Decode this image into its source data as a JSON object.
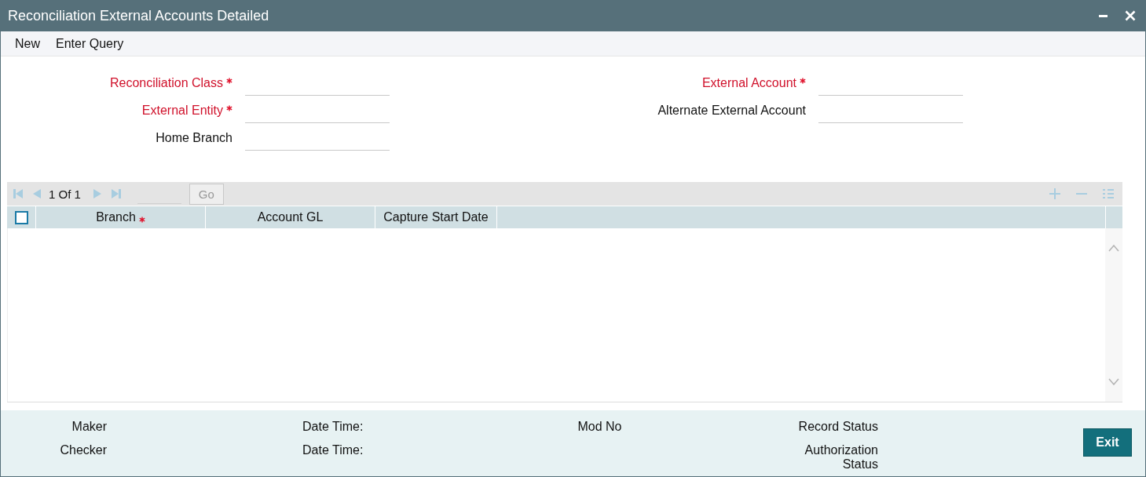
{
  "window": {
    "title": "Reconciliation External Accounts Detailed"
  },
  "menu": [
    {
      "label": "New"
    },
    {
      "label": "Enter Query"
    }
  ],
  "form": {
    "left": [
      {
        "label": "Reconciliation Class",
        "required": true
      },
      {
        "label": "External Entity",
        "required": true
      },
      {
        "label": "Home Branch",
        "required": false
      }
    ],
    "right": [
      {
        "label": "External Account",
        "required": true
      },
      {
        "label": "Alternate External Account",
        "required": false
      }
    ]
  },
  "grid": {
    "pager": "1 Of 1",
    "go": {
      "label": "Go",
      "disabled": true
    },
    "select_all": {
      "checked": false
    },
    "columns": [
      {
        "label": "Branch",
        "required": true
      },
      {
        "label": "Account GL",
        "required": false
      },
      {
        "label": "Capture Start Date",
        "required": false
      }
    ]
  },
  "footer": {
    "maker": "Maker",
    "maker_date_time": "Date Time:",
    "mod_no": "Mod No",
    "record_status": "Record Status",
    "checker": "Checker",
    "checker_date_time": "Date Time:",
    "authorization_status": "Authorization Status",
    "exit": "Exit"
  }
}
